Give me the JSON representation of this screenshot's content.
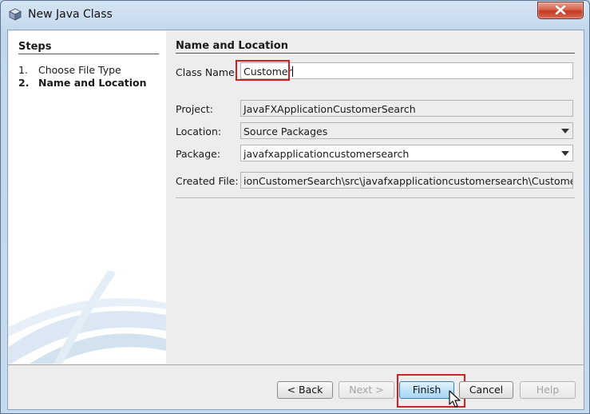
{
  "window": {
    "title": "New Java Class",
    "close_icon": "close-x-icon",
    "app_icon": "java-cube-icon"
  },
  "steps": {
    "heading": "Steps",
    "items": [
      {
        "number": "1.",
        "label": "Choose File Type",
        "active": false
      },
      {
        "number": "2.",
        "label": "Name and Location",
        "active": true
      }
    ]
  },
  "main": {
    "heading": "Name and Location",
    "class_name": {
      "label": "Class Name:",
      "value": "Customer"
    },
    "project": {
      "label": "Project:",
      "value": "JavaFXApplicationCustomerSearch"
    },
    "location": {
      "label": "Location:",
      "value": "Source Packages"
    },
    "package": {
      "label": "Package:",
      "value": "javafxapplicationcustomersearch"
    },
    "created_file": {
      "label": "Created File:",
      "value": "ionCustomerSearch\\src\\javafxapplicationcustomersearch\\Customer.java"
    }
  },
  "buttons": {
    "back": "< Back",
    "next": "Next >",
    "finish": "Finish",
    "cancel": "Cancel",
    "help": "Help"
  },
  "colors": {
    "highlight": "#d42020",
    "primary_button": "#a6d6f3"
  }
}
